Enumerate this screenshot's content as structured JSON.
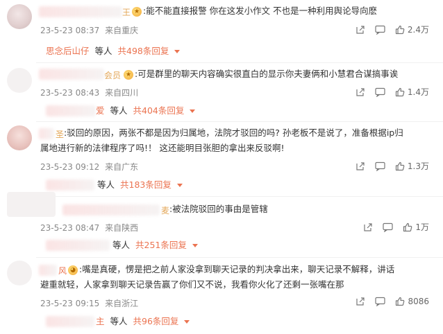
{
  "comments": [
    {
      "user_suffix": "王",
      "text_lines": [
        ":能不能直接报警 你在这发小作文 不也是一种利用舆论导向麽"
      ],
      "time": "23-5-23 08:37",
      "location": "来自重庆",
      "likes": "2.4万",
      "reply": {
        "name": "思念后山仔",
        "middle": "等人",
        "count": "共498条回复"
      }
    },
    {
      "user_suffix": "会员",
      "text_lines": [
        ":可是群里的聊天内容确实很直白的显示你夫妻俩和小慧君合谋搞事诶"
      ],
      "time": "23-5-23 08:43",
      "location": "来自四川",
      "likes": "1.4万",
      "reply": {
        "name": "爱",
        "middle": "等人",
        "count": "共404条回复"
      }
    },
    {
      "user_suffix": "圣",
      "text_lines": [
        ":驳回的原因，两张不都是因为归属地，法院才驳回的吗? 孙老板不是说了，准备根据ip归",
        "属地进行新的法律程序了吗!！ 这还能明目张胆的拿出来反驳啊!"
      ],
      "time": "23-5-23 09:12",
      "location": "来自广东",
      "likes": "1.3万",
      "reply": {
        "name": "",
        "middle": "等人",
        "count": "共183条回复"
      }
    },
    {
      "user_suffix": "麦",
      "text_lines": [
        ":被法院驳回的事由是管辖"
      ],
      "time": "23-5-23 08:47",
      "location": "来自陕西",
      "likes": "1万",
      "reply": {
        "name": "",
        "middle": "等人",
        "count": "共251条回复"
      }
    },
    {
      "user_suffix": "风",
      "text_lines": [
        ":嘴是真硬，愣是把之前人家没拿到聊天记录的判决拿出来，聊天记录不解释，讲话",
        "避重就轻，人家拿到聊天记录告赢了你们又不说，我看你火化了还剩一张嘴在那"
      ],
      "time": "23-5-23 09:15",
      "location": "来自浙江",
      "likes": "8086",
      "reply": {
        "name": "主",
        "middle": "等人",
        "count": "共96条回复"
      }
    }
  ],
  "colors": {
    "accent": "#eb7350",
    "meta": "#888888",
    "text": "#333333",
    "vip": "#e3a657"
  },
  "icons": [
    "share-icon",
    "comment-icon",
    "like-icon",
    "chevron-down-icon",
    "vip-badge-icon"
  ]
}
